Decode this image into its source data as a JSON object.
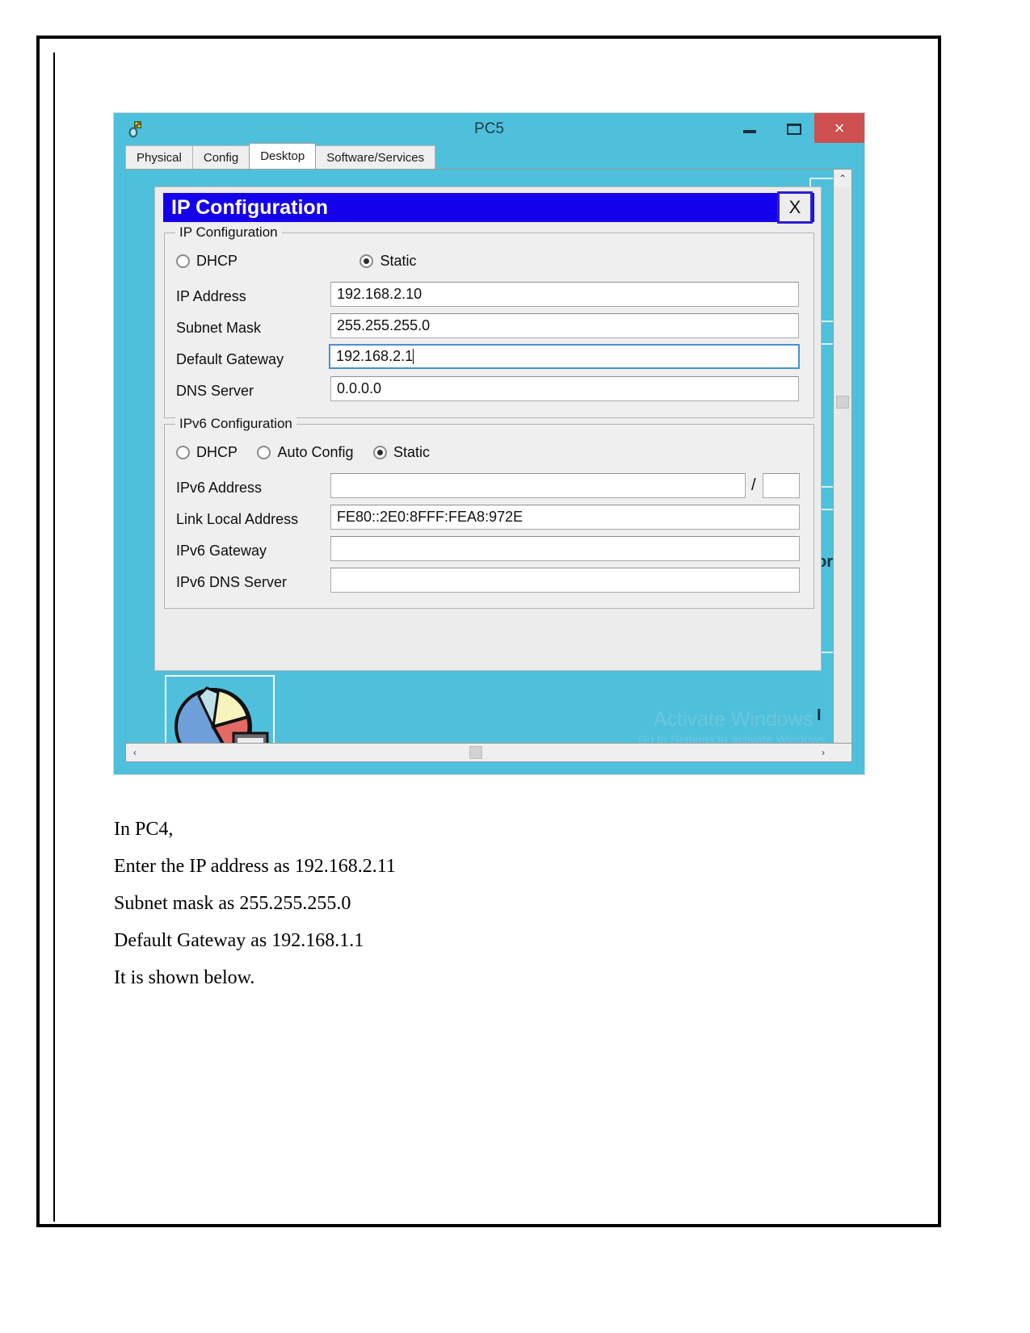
{
  "window": {
    "title": "PC5",
    "app_icon": "packet-tracer-icon",
    "buttons": {
      "minimize": "–",
      "maximize": "□",
      "close": "×"
    },
    "tabs": [
      {
        "label": "Physical",
        "active": false
      },
      {
        "label": "Config",
        "active": false
      },
      {
        "label": "Desktop",
        "active": true
      },
      {
        "label": "Software/Services",
        "active": false
      }
    ]
  },
  "dialog": {
    "title": "IP Configuration",
    "close_label": "X",
    "ipv4": {
      "legend": "IP Configuration",
      "modes": [
        {
          "label": "DHCP",
          "selected": false
        },
        {
          "label": "Static",
          "selected": true
        }
      ],
      "fields": [
        {
          "label": "IP Address",
          "value": "192.168.2.10",
          "focused": false
        },
        {
          "label": "Subnet Mask",
          "value": "255.255.255.0",
          "focused": false
        },
        {
          "label": "Default Gateway",
          "value": "192.168.2.1",
          "focused": true
        },
        {
          "label": "DNS Server",
          "value": "0.0.0.0",
          "focused": false
        }
      ]
    },
    "ipv6": {
      "legend": "IPv6 Configuration",
      "modes": [
        {
          "label": "DHCP",
          "selected": false
        },
        {
          "label": "Auto Config",
          "selected": false
        },
        {
          "label": "Static",
          "selected": true
        }
      ],
      "fields": [
        {
          "label": "IPv6 Address",
          "value": "",
          "prefix": "",
          "separator": "/"
        },
        {
          "label": "Link Local Address",
          "value": "FE80::2E0:8FFF:FEA8:972E"
        },
        {
          "label": "IPv6 Gateway",
          "value": ""
        },
        {
          "label": "IPv6 DNS Server",
          "value": ""
        }
      ]
    }
  },
  "background_hints": {
    "text_right_mid": "-",
    "text_right_or": "or",
    "text_right_bar": "I"
  },
  "watermark": {
    "line1": "Activate Windows",
    "line2": "Go to Settings to activate Windows."
  },
  "scrollbars": {
    "up_arrow": "⌃",
    "down_arrow": "⌄",
    "left_arrow": "‹",
    "right_arrow": "›"
  },
  "document_text": {
    "lines": [
      "In PC4,",
      "Enter the IP address as 192.168.2.11",
      "Subnet mask as 255.255.255.0",
      "Default Gateway as 192.168.1.1",
      "It is shown below."
    ]
  },
  "colors": {
    "titlebar": "#4fc0dc",
    "close_red": "#ce5050",
    "dialog_title_blue": "#1500ec",
    "desktop_cyan": "#4fc0dc",
    "focus_blue": "#4a8fd4"
  }
}
